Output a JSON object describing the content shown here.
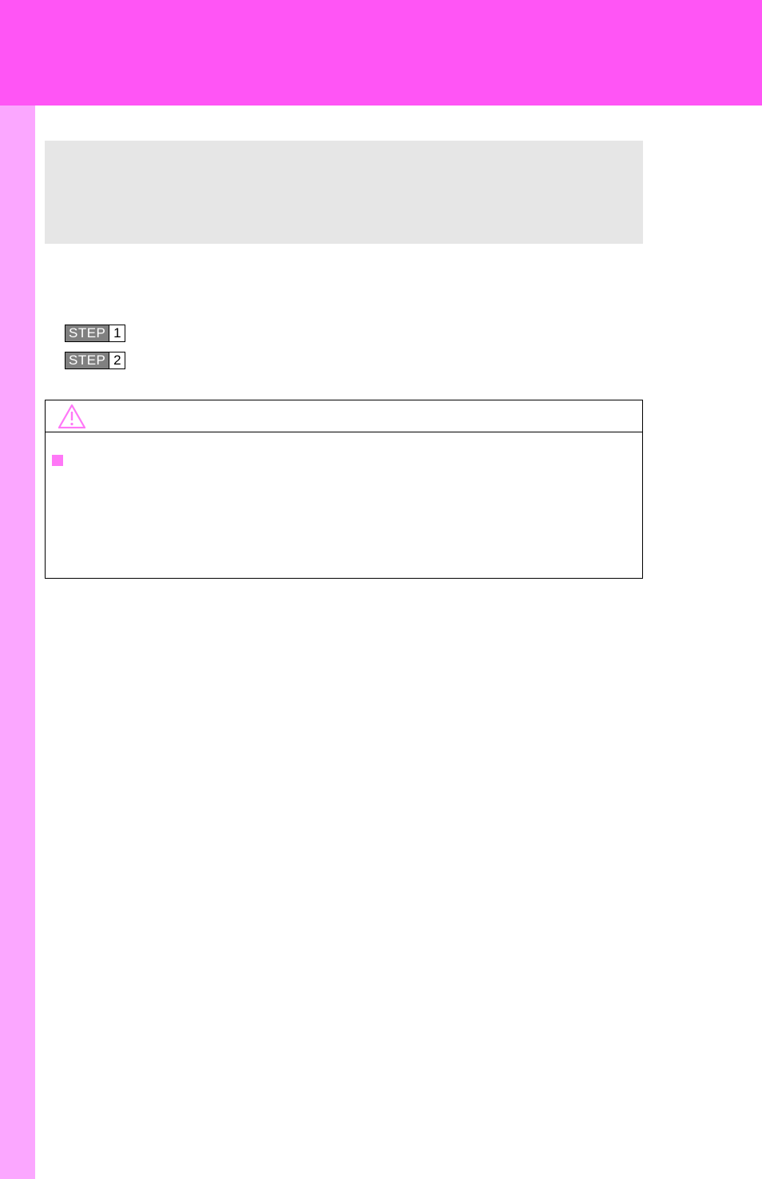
{
  "colors": {
    "topband": "#ff55f5",
    "sidebar": "#fba7ff",
    "graybox": "#e6e6e6",
    "warn_icon": "#ff78f7",
    "pink_square": "#ff78f7"
  },
  "steps": [
    {
      "label": "STEP",
      "number": "1"
    },
    {
      "label": "STEP",
      "number": "2"
    }
  ],
  "warning": {
    "icon": "warning-triangle",
    "bullet_marker": "■"
  }
}
